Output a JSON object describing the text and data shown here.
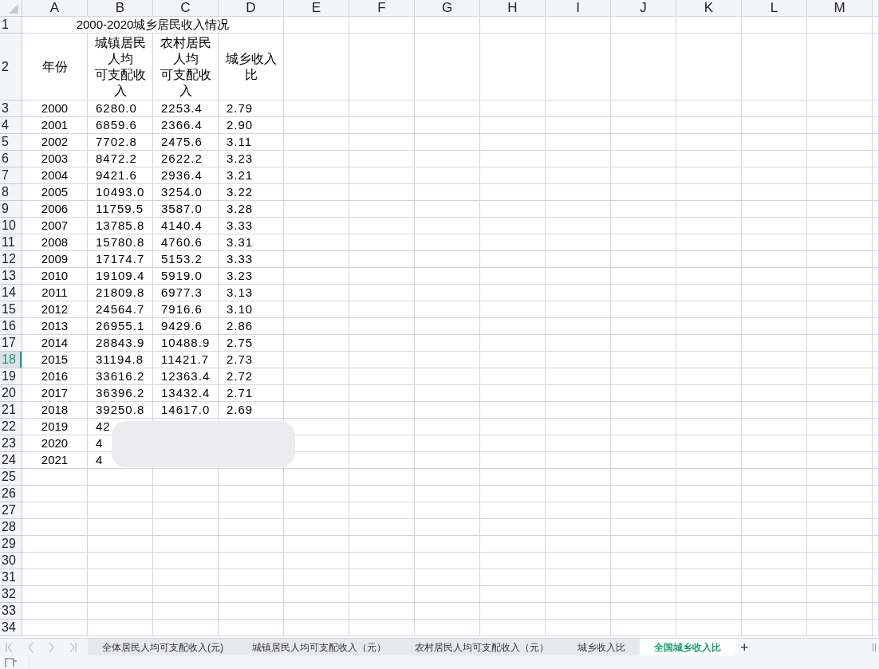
{
  "columns": [
    "A",
    "B",
    "C",
    "D",
    "E",
    "F",
    "G",
    "H",
    "I",
    "J",
    "K",
    "L",
    "M"
  ],
  "title_row": {
    "number": "1",
    "selected": false,
    "text": "2000-2020城乡居民收入情况"
  },
  "header_row": {
    "number": "2",
    "selected": false,
    "cells": [
      [
        "年份"
      ],
      [
        "城镇居民人均",
        "可支配收入"
      ],
      [
        "农村居民人均",
        "可支配收入"
      ],
      [
        "城乡收入比"
      ]
    ]
  },
  "rows": [
    {
      "number": "3",
      "selected": false,
      "cells": [
        "2000",
        "6280.0",
        "2253.4",
        "2.79"
      ]
    },
    {
      "number": "4",
      "selected": false,
      "cells": [
        "2001",
        "6859.6",
        "2366.4",
        "2.90"
      ]
    },
    {
      "number": "5",
      "selected": false,
      "cells": [
        "2002",
        "7702.8",
        "2475.6",
        "3.11"
      ]
    },
    {
      "number": "6",
      "selected": false,
      "cells": [
        "2003",
        "8472.2",
        "2622.2",
        "3.23"
      ]
    },
    {
      "number": "7",
      "selected": false,
      "cells": [
        "2004",
        "9421.6",
        "2936.4",
        "3.21"
      ]
    },
    {
      "number": "8",
      "selected": false,
      "cells": [
        "2005",
        "10493.0",
        "3254.0",
        "3.22"
      ]
    },
    {
      "number": "9",
      "selected": false,
      "cells": [
        "2006",
        "11759.5",
        "3587.0",
        "3.28"
      ]
    },
    {
      "number": "10",
      "selected": false,
      "cells": [
        "2007",
        "13785.8",
        "4140.4",
        "3.33"
      ]
    },
    {
      "number": "11",
      "selected": false,
      "cells": [
        "2008",
        "15780.8",
        "4760.6",
        "3.31"
      ]
    },
    {
      "number": "12",
      "selected": false,
      "cells": [
        "2009",
        "17174.7",
        "5153.2",
        "3.33"
      ]
    },
    {
      "number": "13",
      "selected": false,
      "cells": [
        "2010",
        "19109.4",
        "5919.0",
        "3.23"
      ]
    },
    {
      "number": "14",
      "selected": false,
      "cells": [
        "2011",
        "21809.8",
        "6977.3",
        "3.13"
      ]
    },
    {
      "number": "15",
      "selected": false,
      "cells": [
        "2012",
        "24564.7",
        "7916.6",
        "3.10"
      ]
    },
    {
      "number": "16",
      "selected": false,
      "cells": [
        "2013",
        "26955.1",
        "9429.6",
        "2.86"
      ]
    },
    {
      "number": "17",
      "selected": false,
      "cells": [
        "2014",
        "28843.9",
        "10488.9",
        "2.75"
      ]
    },
    {
      "number": "18",
      "selected": true,
      "cells": [
        "2015",
        "31194.8",
        "11421.7",
        "2.73"
      ]
    },
    {
      "number": "19",
      "selected": false,
      "cells": [
        "2016",
        "33616.2",
        "12363.4",
        "2.72"
      ]
    },
    {
      "number": "20",
      "selected": false,
      "cells": [
        "2017",
        "36396.2",
        "13432.4",
        "2.71"
      ]
    },
    {
      "number": "21",
      "selected": false,
      "cells": [
        "2018",
        "39250.8",
        "14617.0",
        "2.69"
      ]
    },
    {
      "number": "22",
      "selected": false,
      "cells": [
        "2019",
        "42"
      ]
    },
    {
      "number": "23",
      "selected": false,
      "cells": [
        "2020",
        "4"
      ]
    },
    {
      "number": "24",
      "selected": false,
      "cells": [
        "2021",
        "4"
      ]
    },
    {
      "number": "25",
      "selected": false,
      "cells": []
    },
    {
      "number": "26",
      "selected": false,
      "cells": []
    },
    {
      "number": "27",
      "selected": false,
      "cells": []
    },
    {
      "number": "28",
      "selected": false,
      "cells": []
    },
    {
      "number": "29",
      "selected": false,
      "cells": []
    },
    {
      "number": "30",
      "selected": false,
      "cells": []
    },
    {
      "number": "31",
      "selected": false,
      "cells": []
    },
    {
      "number": "32",
      "selected": false,
      "cells": []
    },
    {
      "number": "33",
      "selected": false,
      "cells": []
    },
    {
      "number": "34",
      "selected": false,
      "cells": []
    }
  ],
  "sheet_tabs": [
    {
      "label": "全体居民人均可支配收入(元)",
      "selected": false
    },
    {
      "label": "城镇居民人均可支配收入（元）",
      "selected": false
    },
    {
      "label": "农村居民人均可支配收入（元）",
      "selected": false
    },
    {
      "label": "城乡收入比",
      "selected": false
    },
    {
      "label": "全国城乡收入比",
      "selected": true
    }
  ],
  "add_sheet": "+"
}
